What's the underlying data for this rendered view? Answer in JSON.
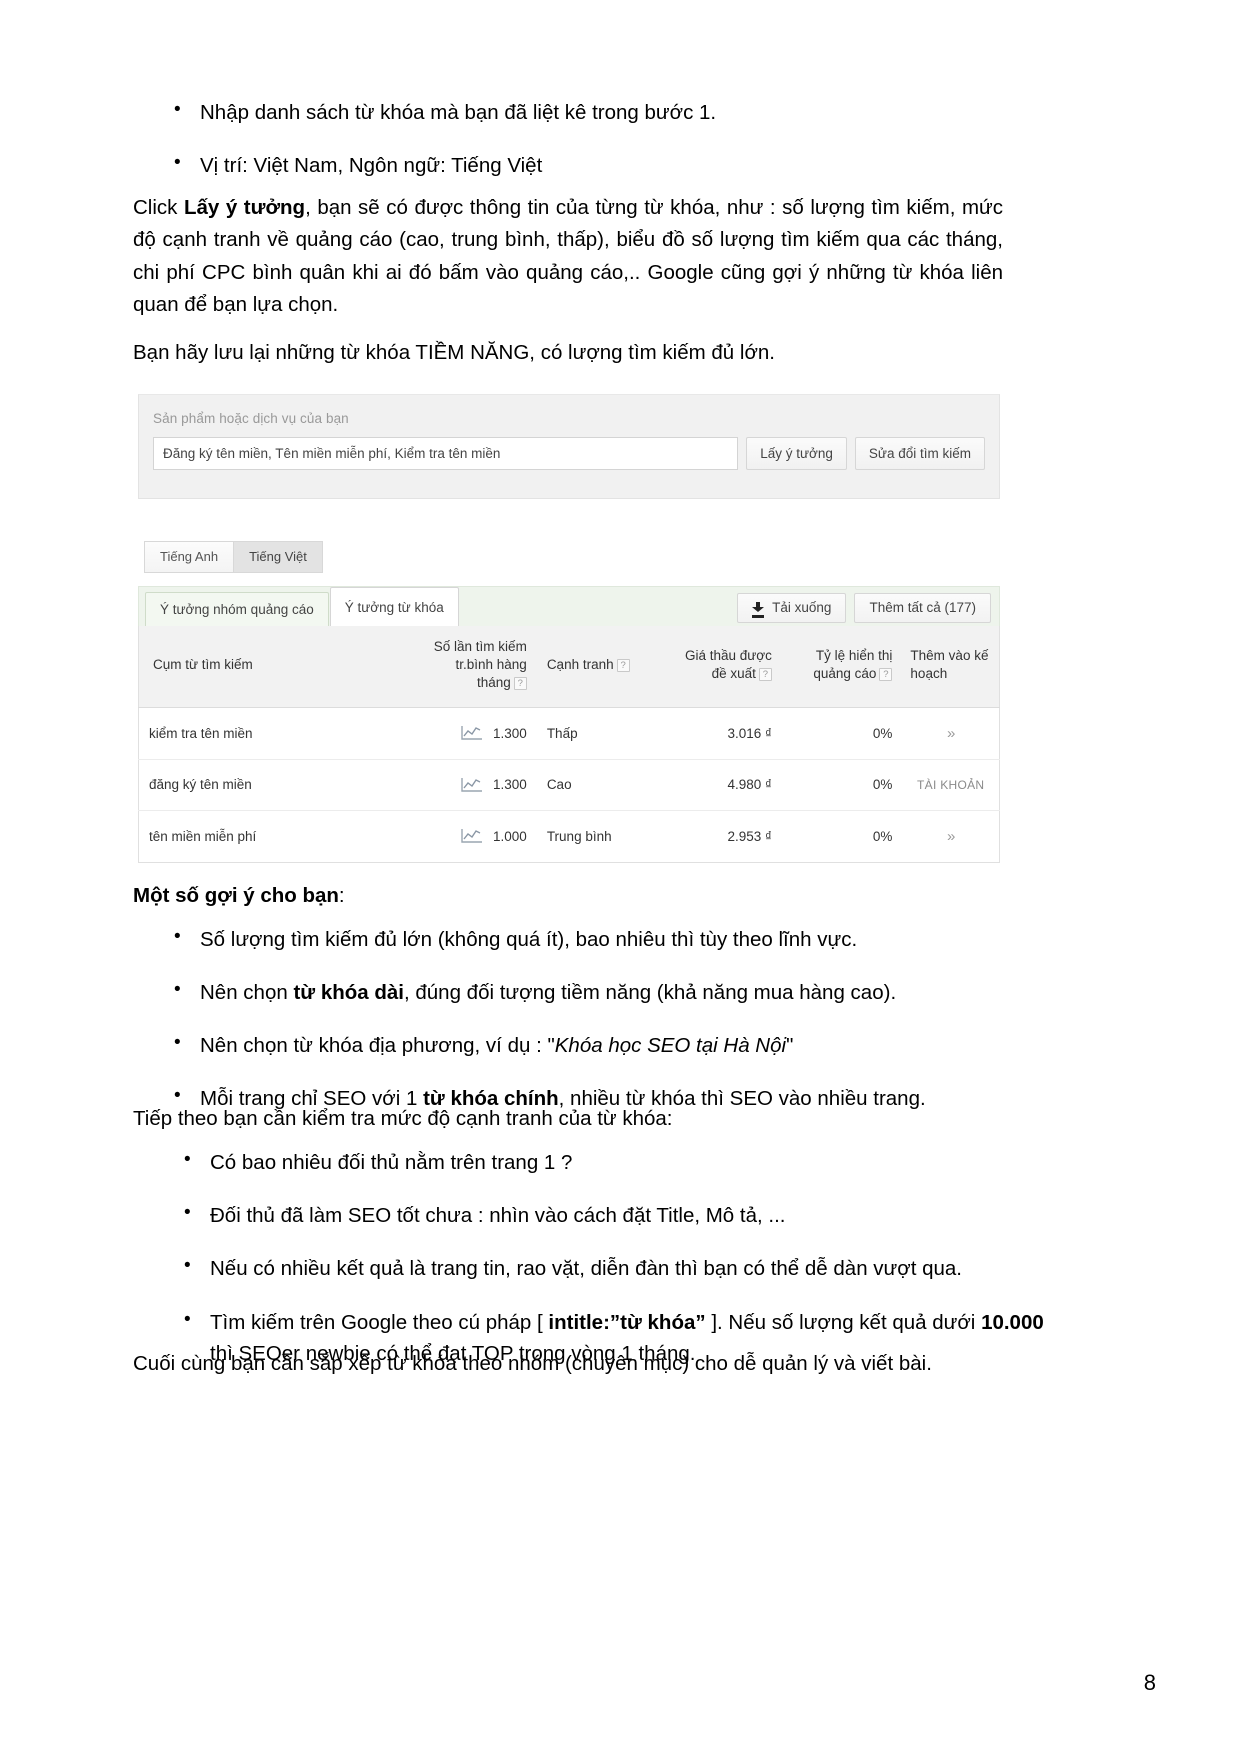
{
  "document": {
    "page_number": "8",
    "top_bullets": [
      "Nhập danh sách từ khóa mà bạn đã liệt kê trong bước 1.",
      "Vị trí: Việt Nam,  Ngôn ngữ: Tiếng Việt"
    ],
    "paragraph1": {
      "prefix": "Click ",
      "bold": "Lấy ý tưởng",
      "rest": ", bạn sẽ có được thông tin của từng từ khóa, như : số lượng tìm kiếm, mức độ cạnh tranh về quảng cáo (cao, trung bình, thấp), biểu đồ số lượng tìm kiếm qua các tháng, chi phí CPC bình quân khi ai đó bấm vào quảng cáo,.. Google cũng gợi ý những từ khóa liên quan để bạn lựa chọn."
    },
    "paragraph2": "Bạn hãy lưu lại những từ khóa TIỀM NĂNG, có lượng tìm kiếm đủ lớn.",
    "tips_heading": {
      "bold": "Một số gợi ý cho bạn",
      "rest": ":"
    },
    "tips": [
      {
        "text": "Số lượng tìm kiếm đủ lớn (không quá ít), bao nhiêu thì tùy theo lĩnh vực."
      },
      {
        "pre": "Nên chọn ",
        "bold": "từ khóa dài",
        "post": ", đúng đối tượng tiềm năng (khả năng mua hàng cao)."
      },
      {
        "pre": "Nên chọn từ khóa địa phương, ví dụ : \"",
        "italic": "Khóa học SEO tại Hà Nội",
        "post": "\""
      },
      {
        "pre": "Mỗi trang chỉ SEO với 1 ",
        "bold": "từ khóa chính",
        "post": ", nhiều từ khóa thì SEO vào nhiều trang."
      }
    ],
    "paragraph3": "Tiếp theo bạn cần kiểm tra mức độ cạnh tranh của từ khóa:",
    "competition_bullets": [
      {
        "text": "Có bao nhiêu đối thủ nằm trên trang 1 ?"
      },
      {
        "text": "Đối thủ đã làm SEO tốt chưa : nhìn vào cách đặt Title, Mô tả, ..."
      },
      {
        "text": "Nếu có nhiều kết quả là trang tin, rao vặt, diễn đàn thì bạn có thể dễ dàn vượt qua."
      },
      {
        "pre": "Tìm kiếm trên Google theo cú pháp [ ",
        "bold": "intitle:”từ khóa”",
        "mid": " ]. Nếu số lượng kết quả dưới ",
        "bold2": "10.000",
        "post": " thì SEOer newbie có thể đạt TOP trong vòng 1 tháng."
      }
    ],
    "paragraph4": "Cuối cùng bạn cần sắp xếp từ khóa theo nhóm (chuyên mục) cho dễ quản lý và viết bài."
  },
  "keyword_planner": {
    "search_label": "Sản phẩm hoặc dịch vụ của bạn",
    "search_value": "Đăng ký tên miền, Tên miền miễn phí, Kiểm tra tên miền",
    "get_ideas_button": "Lấy ý tưởng",
    "modify_search_button": "Sửa đổi tìm kiếm",
    "language_tabs": [
      {
        "label": "Tiếng Anh",
        "active": false
      },
      {
        "label": "Tiếng Việt",
        "active": true
      }
    ],
    "idea_tabs": [
      {
        "label": "Ý tưởng nhóm quảng cáo",
        "active": false
      },
      {
        "label": "Ý tưởng từ khóa",
        "active": true
      }
    ],
    "download_button": "Tải xuống",
    "add_all_button": "Thêm tất cả (177)",
    "table": {
      "headers": {
        "keyword": "Cụm từ tìm kiếm",
        "searches": "Số lần tìm kiếm tr.bình hàng tháng",
        "competition": "Cạnh tranh",
        "bid": "Giá thầu được đề xuất",
        "impression_share": "Tỷ lệ hiển thị quảng cáo",
        "add_to_plan": "Thêm vào kế hoạch",
        "help_glyph": "?"
      },
      "rows": [
        {
          "keyword": "kiểm tra tên miền",
          "searches": "1.300",
          "competition": "Thấp",
          "bid": "3.016 ₫",
          "impression_share": "0%",
          "add_action": "»",
          "add_type": "chevron"
        },
        {
          "keyword": "đăng ký tên miền",
          "searches": "1.300",
          "competition": "Cao",
          "bid": "4.980 ₫",
          "impression_share": "0%",
          "add_action": "TÀI KHOẢN",
          "add_type": "account"
        },
        {
          "keyword": "tên miền miễn phí",
          "searches": "1.000",
          "competition": "Trung bình",
          "bid": "2.953 ₫",
          "impression_share": "0%",
          "add_action": "»",
          "add_type": "chevron"
        }
      ]
    }
  }
}
